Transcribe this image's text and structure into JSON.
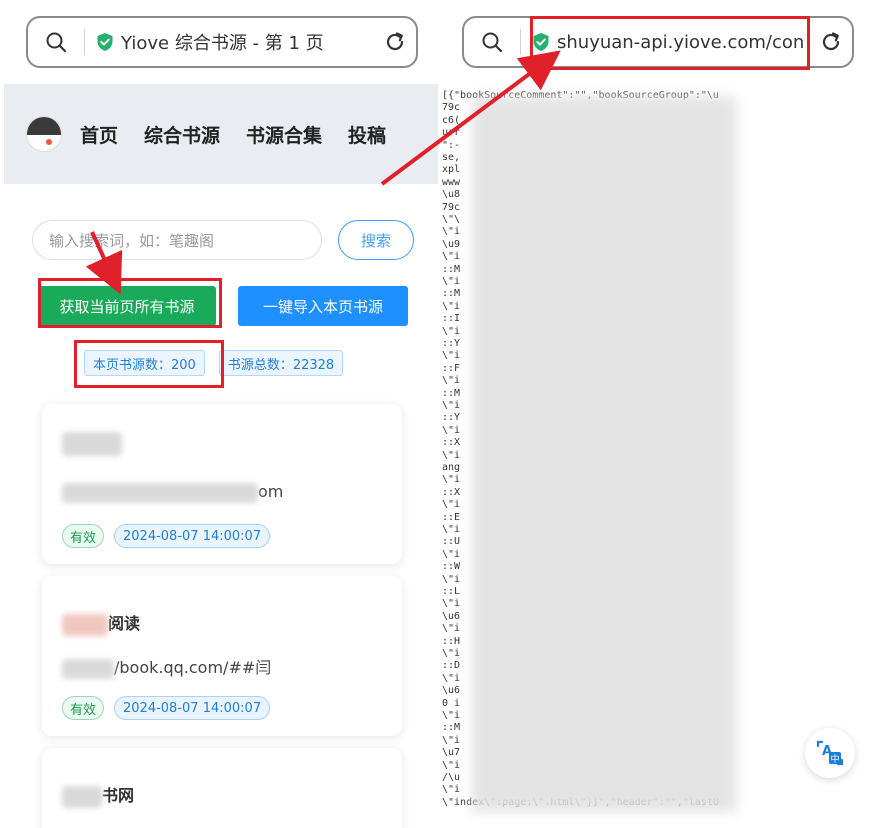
{
  "left_browser": {
    "title": "Yiove 综合书源 - 第 1 页"
  },
  "right_browser": {
    "url": "shuyuan-api.yiove.com/con"
  },
  "nav": {
    "items": [
      "首页",
      "综合书源",
      "书源合集",
      "投稿"
    ]
  },
  "search": {
    "placeholder": "输入搜索词，如：笔趣阁",
    "button": "搜索"
  },
  "actions": {
    "get_all": "获取当前页所有书源",
    "import": "一键导入本页书源"
  },
  "stats": {
    "page_count": "本页书源数：200",
    "total_count": "书源总数：22328"
  },
  "cards": [
    {
      "title": "",
      "url_suffix": "om",
      "status": "有效",
      "date": "2024-08-07 14:00:07"
    },
    {
      "title": "阅读",
      "url_suffix": "/book.qq.com/##闫",
      "status": "有效",
      "date": "2024-08-07 14:00:07"
    },
    {
      "title": "书网"
    }
  ],
  "json_view": {
    "lines": [
      "[{\"bookSourceComment\":\"\",\"bookSourceGroup\":\"\\u",
      "79c",
      "c6(",
      "urr",
      "\":-",
      "se,",
      "xpl",
      "www",
      "\\u8",
      "79c",
      "\\\"\\",
      "\\\"i",
      "\\u9",
      "\\\"i",
      "::M",
      "\\\"i",
      "::M",
      "\\\"i",
      "::I",
      "\\\"i",
      "::Y",
      "\\\"i",
      "::F",
      "\\\"i",
      "::M",
      "\\\"i",
      "::Y",
      "\\\"i",
      "::X",
      "\\\"i",
      "ang",
      "\\\"i",
      "::X",
      "\\\"i",
      "::E",
      "\\\"i",
      "::U",
      "\\\"i",
      "::W",
      "\\\"i",
      "::L",
      "\\\"i",
      "\\u6",
      "\\\"i",
      "::H",
      "\\\"i",
      "::D",
      "\\\"i",
      "\\u6",
      "0 i",
      "\\\"i",
      "::M",
      "\\\"i",
      "\\u7",
      "\\\"i",
      "/\\u",
      "\\\"i",
      "\\\"index\\\":page:\\\".html\\\"}]\",\"header\":\"\",\"lastU"
    ]
  }
}
